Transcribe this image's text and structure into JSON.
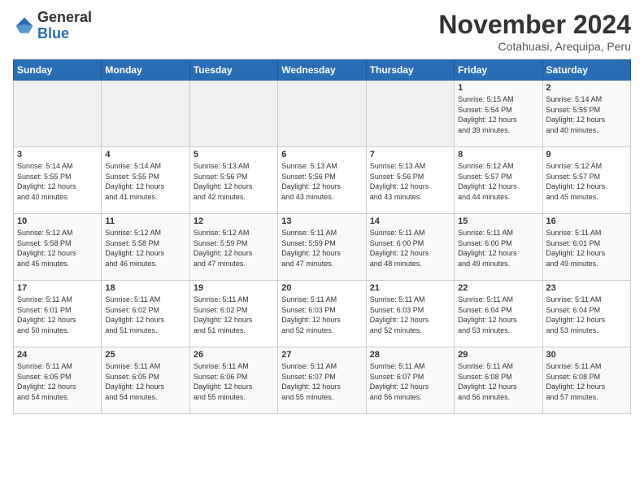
{
  "logo": {
    "general": "General",
    "blue": "Blue"
  },
  "title": "November 2024",
  "subtitle": "Cotahuasi, Arequipa, Peru",
  "days_of_week": [
    "Sunday",
    "Monday",
    "Tuesday",
    "Wednesday",
    "Thursday",
    "Friday",
    "Saturday"
  ],
  "weeks": [
    [
      {
        "day": "",
        "info": ""
      },
      {
        "day": "",
        "info": ""
      },
      {
        "day": "",
        "info": ""
      },
      {
        "day": "",
        "info": ""
      },
      {
        "day": "",
        "info": ""
      },
      {
        "day": "1",
        "info": "Sunrise: 5:15 AM\nSunset: 5:54 PM\nDaylight: 12 hours\nand 39 minutes."
      },
      {
        "day": "2",
        "info": "Sunrise: 5:14 AM\nSunset: 5:55 PM\nDaylight: 12 hours\nand 40 minutes."
      }
    ],
    [
      {
        "day": "3",
        "info": "Sunrise: 5:14 AM\nSunset: 5:55 PM\nDaylight: 12 hours\nand 40 minutes."
      },
      {
        "day": "4",
        "info": "Sunrise: 5:14 AM\nSunset: 5:55 PM\nDaylight: 12 hours\nand 41 minutes."
      },
      {
        "day": "5",
        "info": "Sunrise: 5:13 AM\nSunset: 5:56 PM\nDaylight: 12 hours\nand 42 minutes."
      },
      {
        "day": "6",
        "info": "Sunrise: 5:13 AM\nSunset: 5:56 PM\nDaylight: 12 hours\nand 43 minutes."
      },
      {
        "day": "7",
        "info": "Sunrise: 5:13 AM\nSunset: 5:56 PM\nDaylight: 12 hours\nand 43 minutes."
      },
      {
        "day": "8",
        "info": "Sunrise: 5:12 AM\nSunset: 5:57 PM\nDaylight: 12 hours\nand 44 minutes."
      },
      {
        "day": "9",
        "info": "Sunrise: 5:12 AM\nSunset: 5:57 PM\nDaylight: 12 hours\nand 45 minutes."
      }
    ],
    [
      {
        "day": "10",
        "info": "Sunrise: 5:12 AM\nSunset: 5:58 PM\nDaylight: 12 hours\nand 45 minutes."
      },
      {
        "day": "11",
        "info": "Sunrise: 5:12 AM\nSunset: 5:58 PM\nDaylight: 12 hours\nand 46 minutes."
      },
      {
        "day": "12",
        "info": "Sunrise: 5:12 AM\nSunset: 5:59 PM\nDaylight: 12 hours\nand 47 minutes."
      },
      {
        "day": "13",
        "info": "Sunrise: 5:11 AM\nSunset: 5:59 PM\nDaylight: 12 hours\nand 47 minutes."
      },
      {
        "day": "14",
        "info": "Sunrise: 5:11 AM\nSunset: 6:00 PM\nDaylight: 12 hours\nand 48 minutes."
      },
      {
        "day": "15",
        "info": "Sunrise: 5:11 AM\nSunset: 6:00 PM\nDaylight: 12 hours\nand 49 minutes."
      },
      {
        "day": "16",
        "info": "Sunrise: 5:11 AM\nSunset: 6:01 PM\nDaylight: 12 hours\nand 49 minutes."
      }
    ],
    [
      {
        "day": "17",
        "info": "Sunrise: 5:11 AM\nSunset: 6:01 PM\nDaylight: 12 hours\nand 50 minutes."
      },
      {
        "day": "18",
        "info": "Sunrise: 5:11 AM\nSunset: 6:02 PM\nDaylight: 12 hours\nand 51 minutes."
      },
      {
        "day": "19",
        "info": "Sunrise: 5:11 AM\nSunset: 6:02 PM\nDaylight: 12 hours\nand 51 minutes."
      },
      {
        "day": "20",
        "info": "Sunrise: 5:11 AM\nSunset: 6:03 PM\nDaylight: 12 hours\nand 52 minutes."
      },
      {
        "day": "21",
        "info": "Sunrise: 5:11 AM\nSunset: 6:03 PM\nDaylight: 12 hours\nand 52 minutes."
      },
      {
        "day": "22",
        "info": "Sunrise: 5:11 AM\nSunset: 6:04 PM\nDaylight: 12 hours\nand 53 minutes."
      },
      {
        "day": "23",
        "info": "Sunrise: 5:11 AM\nSunset: 6:04 PM\nDaylight: 12 hours\nand 53 minutes."
      }
    ],
    [
      {
        "day": "24",
        "info": "Sunrise: 5:11 AM\nSunset: 6:05 PM\nDaylight: 12 hours\nand 54 minutes."
      },
      {
        "day": "25",
        "info": "Sunrise: 5:11 AM\nSunset: 6:05 PM\nDaylight: 12 hours\nand 54 minutes."
      },
      {
        "day": "26",
        "info": "Sunrise: 5:11 AM\nSunset: 6:06 PM\nDaylight: 12 hours\nand 55 minutes."
      },
      {
        "day": "27",
        "info": "Sunrise: 5:11 AM\nSunset: 6:07 PM\nDaylight: 12 hours\nand 55 minutes."
      },
      {
        "day": "28",
        "info": "Sunrise: 5:11 AM\nSunset: 6:07 PM\nDaylight: 12 hours\nand 56 minutes."
      },
      {
        "day": "29",
        "info": "Sunrise: 5:11 AM\nSunset: 6:08 PM\nDaylight: 12 hours\nand 56 minutes."
      },
      {
        "day": "30",
        "info": "Sunrise: 5:11 AM\nSunset: 6:08 PM\nDaylight: 12 hours\nand 57 minutes."
      }
    ]
  ]
}
